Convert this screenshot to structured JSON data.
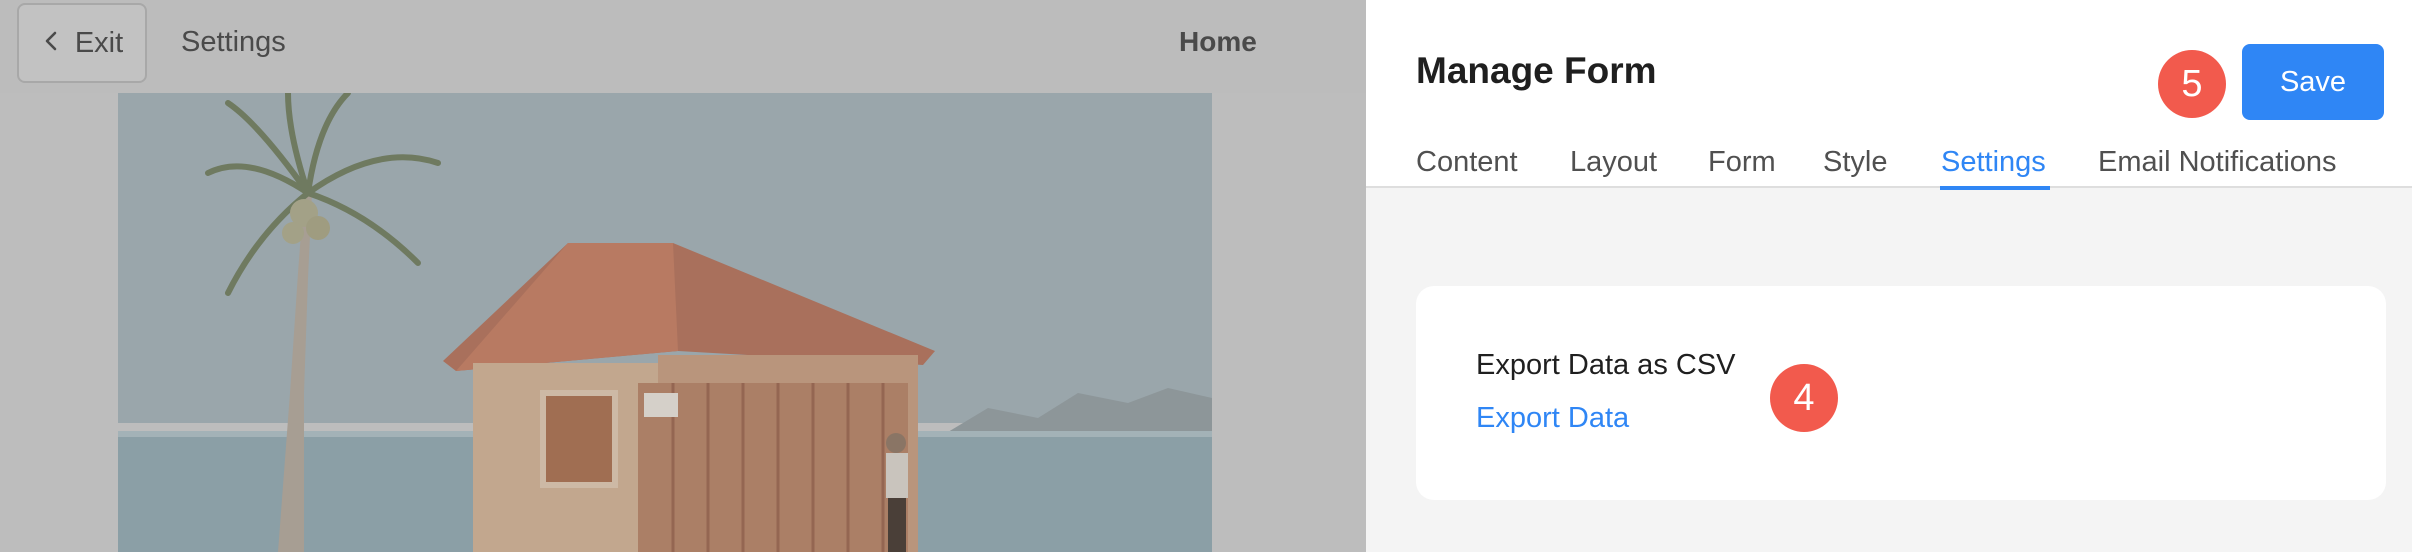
{
  "preview": {
    "exit_label": "Exit",
    "crumb": "Settings",
    "home_link": "Home"
  },
  "panel": {
    "title": "Manage Form",
    "save_label": "Save",
    "tabs": [
      {
        "label": "Content"
      },
      {
        "label": "Layout"
      },
      {
        "label": "Form"
      },
      {
        "label": "Style"
      },
      {
        "label": "Settings",
        "active": true
      },
      {
        "label": "Email Notifications"
      }
    ],
    "step_badge_save": "5",
    "card": {
      "title": "Export Data as CSV",
      "link": "Export Data",
      "step_badge": "4"
    }
  },
  "colors": {
    "accent": "#2f86f5",
    "badge": "#f25a4d",
    "overlay": "#bdbdbd"
  }
}
